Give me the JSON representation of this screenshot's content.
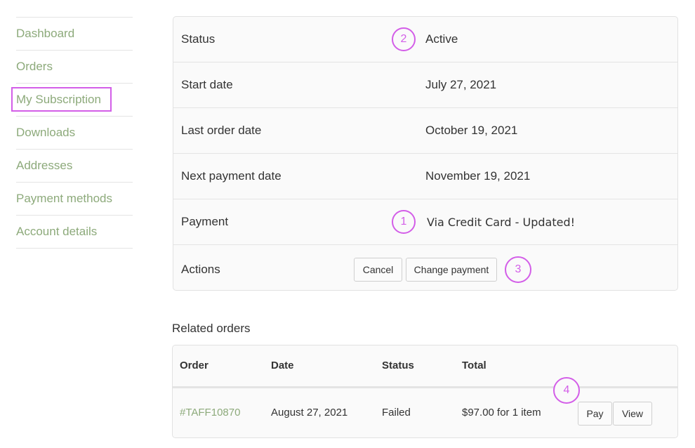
{
  "sidebar": {
    "items": [
      {
        "label": "Dashboard"
      },
      {
        "label": "Orders"
      },
      {
        "label": "My Subscription",
        "active": true
      },
      {
        "label": "Downloads"
      },
      {
        "label": "Addresses"
      },
      {
        "label": "Payment methods"
      },
      {
        "label": "Account details"
      }
    ]
  },
  "subscription": {
    "rows": [
      {
        "label": "Status",
        "value": "Active"
      },
      {
        "label": "Start date",
        "value": "July 27, 2021"
      },
      {
        "label": "Last order date",
        "value": "October 19, 2021"
      },
      {
        "label": "Next payment date",
        "value": "November 19, 2021"
      },
      {
        "label": "Payment",
        "value": "Via Credit Card - Updated!"
      },
      {
        "label": "Actions"
      }
    ],
    "actions": {
      "cancel": "Cancel",
      "change_payment": "Change payment"
    }
  },
  "annotations": {
    "one": "1",
    "two": "2",
    "three": "3",
    "four": "4"
  },
  "related_orders": {
    "title": "Related orders",
    "columns": [
      "Order",
      "Date",
      "Status",
      "Total"
    ],
    "rows": [
      {
        "order": "#TAFF10870",
        "date": "August 27, 2021",
        "status": "Failed",
        "total": "$97.00 for 1 item",
        "pay": "Pay",
        "view": "View"
      }
    ]
  }
}
